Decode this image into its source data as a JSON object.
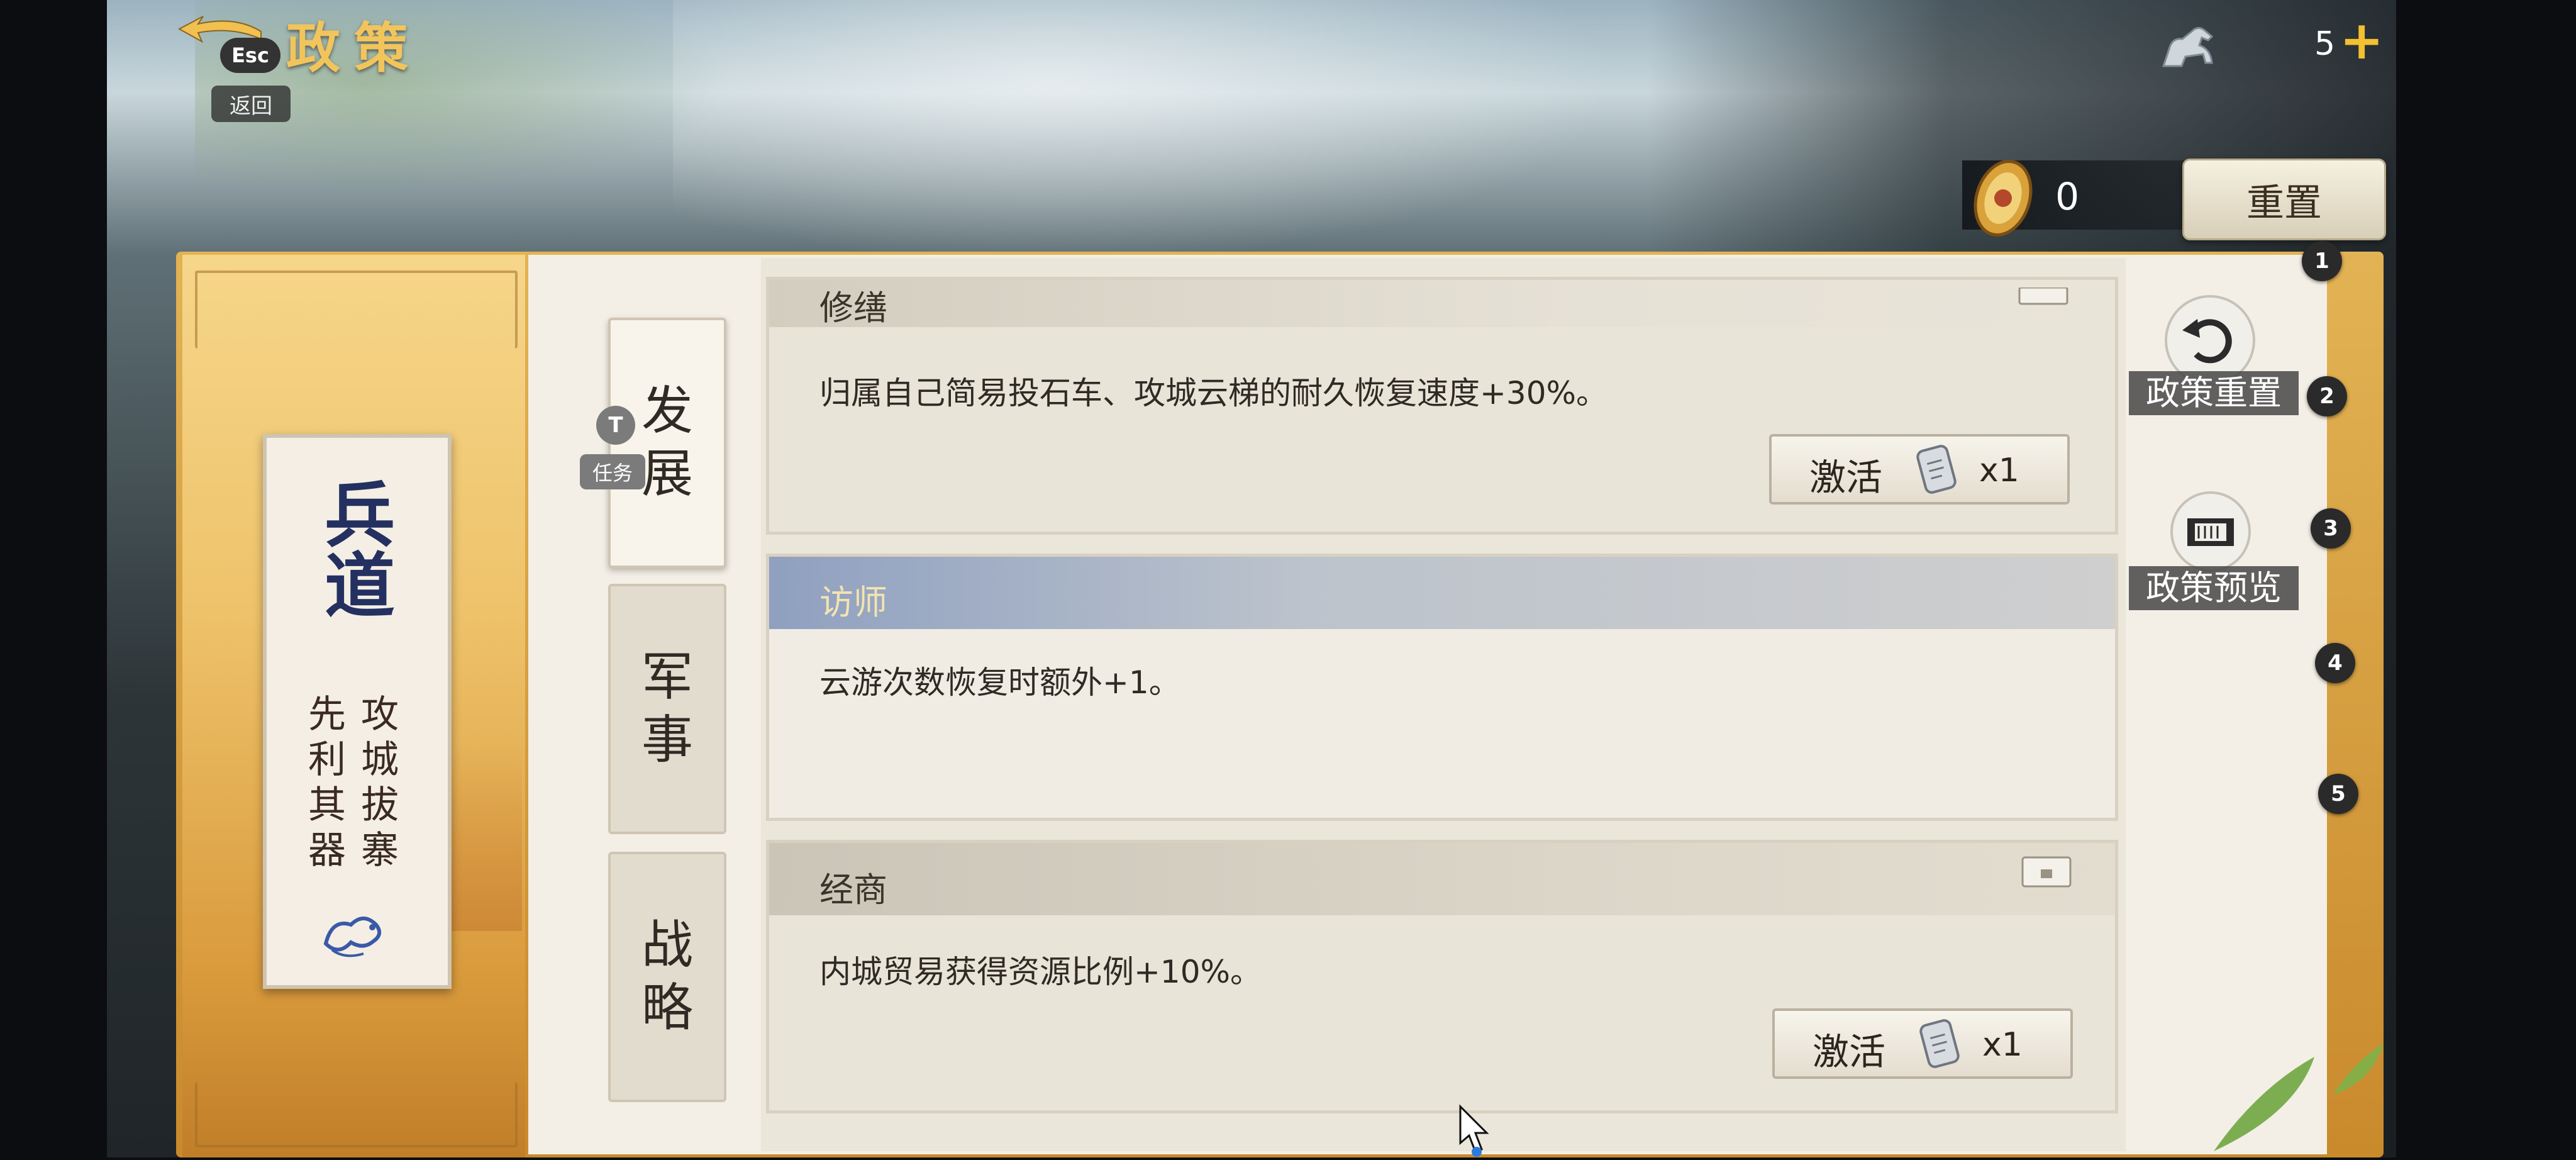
{
  "header": {
    "title": "政策",
    "esc_key": "Esc",
    "back_label": "返回",
    "currency_count": "5",
    "currency_plus": "+"
  },
  "toolbar": {
    "token_count": "0",
    "reset_label": "重置"
  },
  "side_panel": {
    "calligraphy": "兵道",
    "motto_right": "攻城拔寨",
    "motto_left": "先利其器"
  },
  "tabs": [
    {
      "label": "发展"
    },
    {
      "label": "军事"
    },
    {
      "label": "战略"
    }
  ],
  "tab_hotkey": {
    "key": "T",
    "label": "任务"
  },
  "policies": [
    {
      "title": "修缮",
      "description": "归属自己简易投石车、攻城云梯的耐久恢复速度+30%。",
      "action_label": "激活",
      "cost": "x1"
    },
    {
      "title": "访师",
      "description": "云游次数恢复时额外+1。"
    },
    {
      "title": "经商",
      "description": "内城贸易获得资源比例+10%。",
      "action_label": "激活",
      "cost": "x1"
    }
  ],
  "shortcuts": {
    "reset_policy": "政策重置",
    "preview_policy": "政策预览"
  },
  "page_numbers": [
    "1",
    "2",
    "3",
    "4",
    "5"
  ],
  "colors": {
    "title_gold": "#f2c45c",
    "panel_gold": "#e2b354",
    "paper": "#f3efe6",
    "selected_header_blue": "#8fa0c0"
  }
}
